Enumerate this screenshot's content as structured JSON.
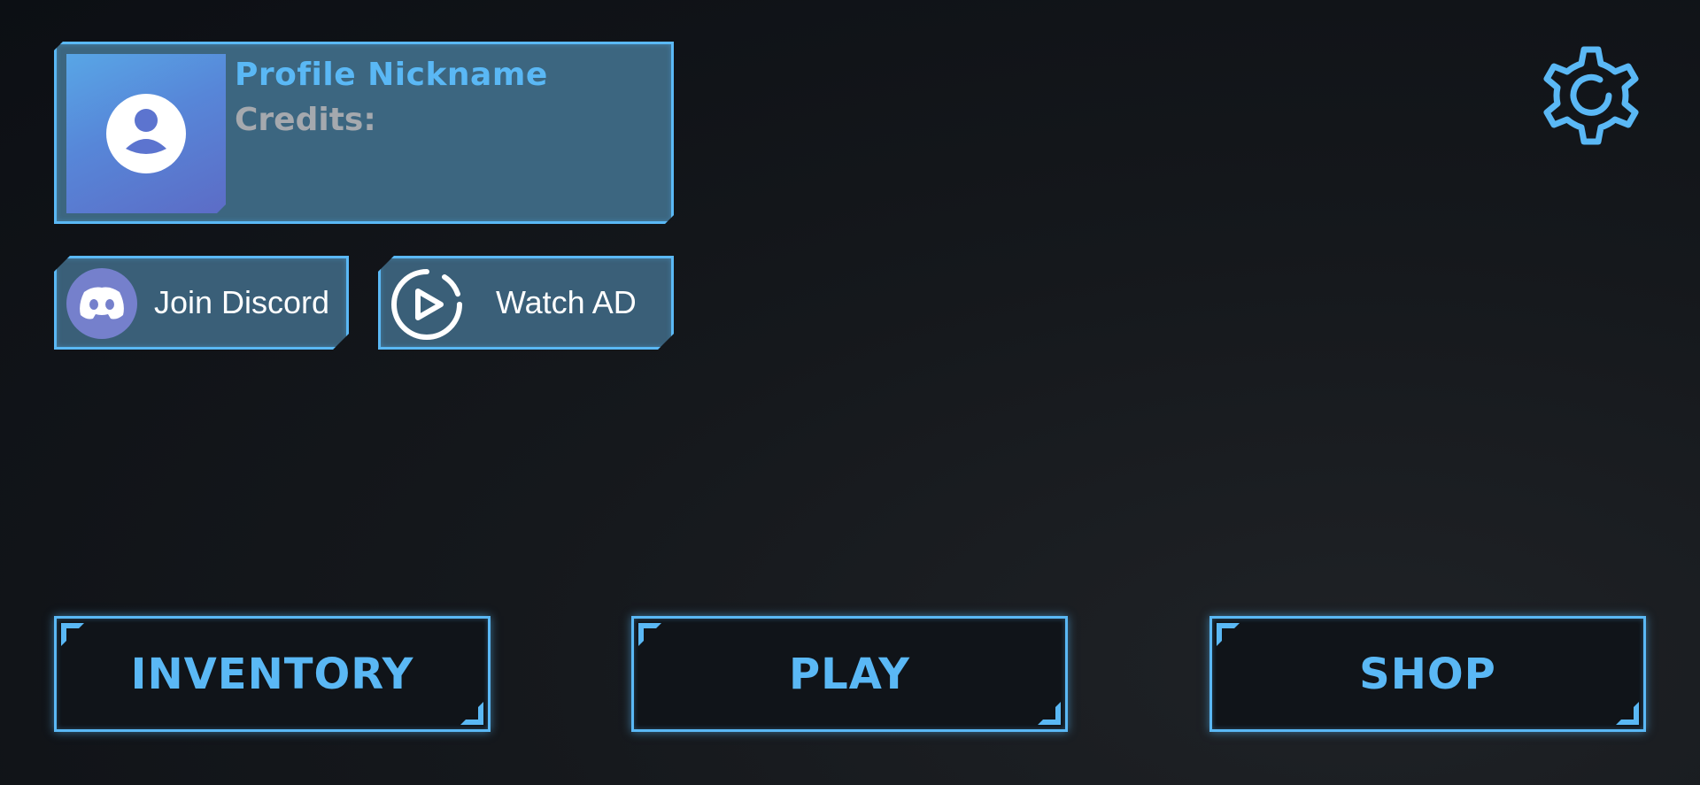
{
  "profile": {
    "nickname": "Profile Nickname",
    "credits_label": "Credits:",
    "avatar_icon": "user-avatar-icon"
  },
  "social": {
    "discord_label": "Join Discord",
    "discord_icon": "discord-logo-icon",
    "watch_ad_label": "Watch AD",
    "watch_ad_icon": "play-circle-icon"
  },
  "menu": {
    "inventory_label": "INVENTORY",
    "play_label": "PLAY",
    "shop_label": "SHOP"
  },
  "settings": {
    "icon": "gear-icon"
  },
  "colors": {
    "accent": "#5ab8f5",
    "panel": "#3c6680",
    "discord": "#7580cc",
    "background": "#0c0f14"
  }
}
